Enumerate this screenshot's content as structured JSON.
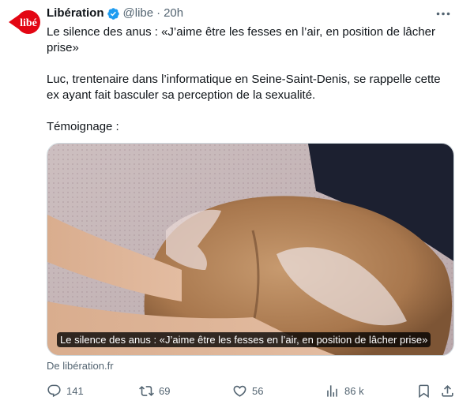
{
  "tweet": {
    "author": {
      "display_name": "Libération",
      "handle": "@libe",
      "time": "20h",
      "avatar_text": "libé",
      "verified": true,
      "brand_color": "#e30613"
    },
    "text": {
      "line1": "Le silence des anus : «J’aime être les fesses en l’air, en position de lâcher prise»",
      "line2": "Luc, trentenaire dans l’informatique en Seine-Saint-Denis, se rappelle cette ex ayant fait basculer sa perception de la sexualité.",
      "line3": "Témoignage :"
    },
    "card": {
      "caption": "Le silence des anus : «J’aime être les fesses en l’air, en position de lâcher prise»",
      "source": "De libération.fr"
    },
    "actions": {
      "replies": "141",
      "reposts": "69",
      "likes": "56",
      "views": "86 k"
    },
    "colors": {
      "verified": "#1d9bf0",
      "muted": "#536471",
      "text": "#0f1419"
    }
  }
}
